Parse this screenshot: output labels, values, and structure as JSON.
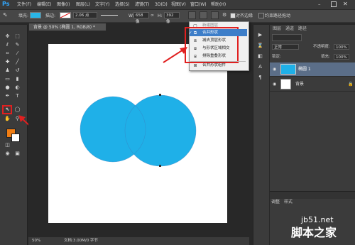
{
  "app": {
    "logo": "Ps"
  },
  "menu": [
    "文件(F)",
    "编辑(E)",
    "图像(I)",
    "图层(L)",
    "文字(Y)",
    "选择(S)",
    "滤镜(T)",
    "3D(D)",
    "视图(V)",
    "窗口(W)",
    "帮助(H)"
  ],
  "options": {
    "fill_label": "填充:",
    "stroke_label": "描边:",
    "stroke_width": "2.06 点",
    "w_label": "W:",
    "w_value": "658 像",
    "h_label": "H:",
    "h_value": "392 像",
    "align_edges": "对齐边缘",
    "constrain": "约束路径拖动",
    "fill_color": "#29b6e8"
  },
  "document": {
    "tab_title": "背景 @ 50% (椭圆 1, RGB/8) *",
    "zoom": "50%",
    "status": "文档:3.00M/0 字节"
  },
  "dropdown": {
    "items": [
      "新建图层",
      "合并形状",
      "减去顶层形状",
      "与形状区域相交",
      "排除重叠形状",
      "合并形状组件"
    ],
    "selected_index": 1
  },
  "layers_panel": {
    "tabs": [
      "图层",
      "通道",
      "路径"
    ],
    "filter_label": "正常",
    "opacity_label": "不透明度:",
    "opacity_value": "100%",
    "lock_label": "锁定:",
    "fill_label": "填充:",
    "fill_value": "100%",
    "layers": [
      {
        "name": "椭圆 1",
        "selected": true
      },
      {
        "name": "背景",
        "selected": false
      }
    ],
    "bottom_tabs": [
      "调整",
      "样式"
    ]
  },
  "watermark": {
    "url": "jb51.net",
    "text": "脚本之家"
  },
  "colors": {
    "shape": "#1fb0e8",
    "selection": "#3d7ec9",
    "annotation": "#e02020",
    "foreground": "#f07d13"
  }
}
